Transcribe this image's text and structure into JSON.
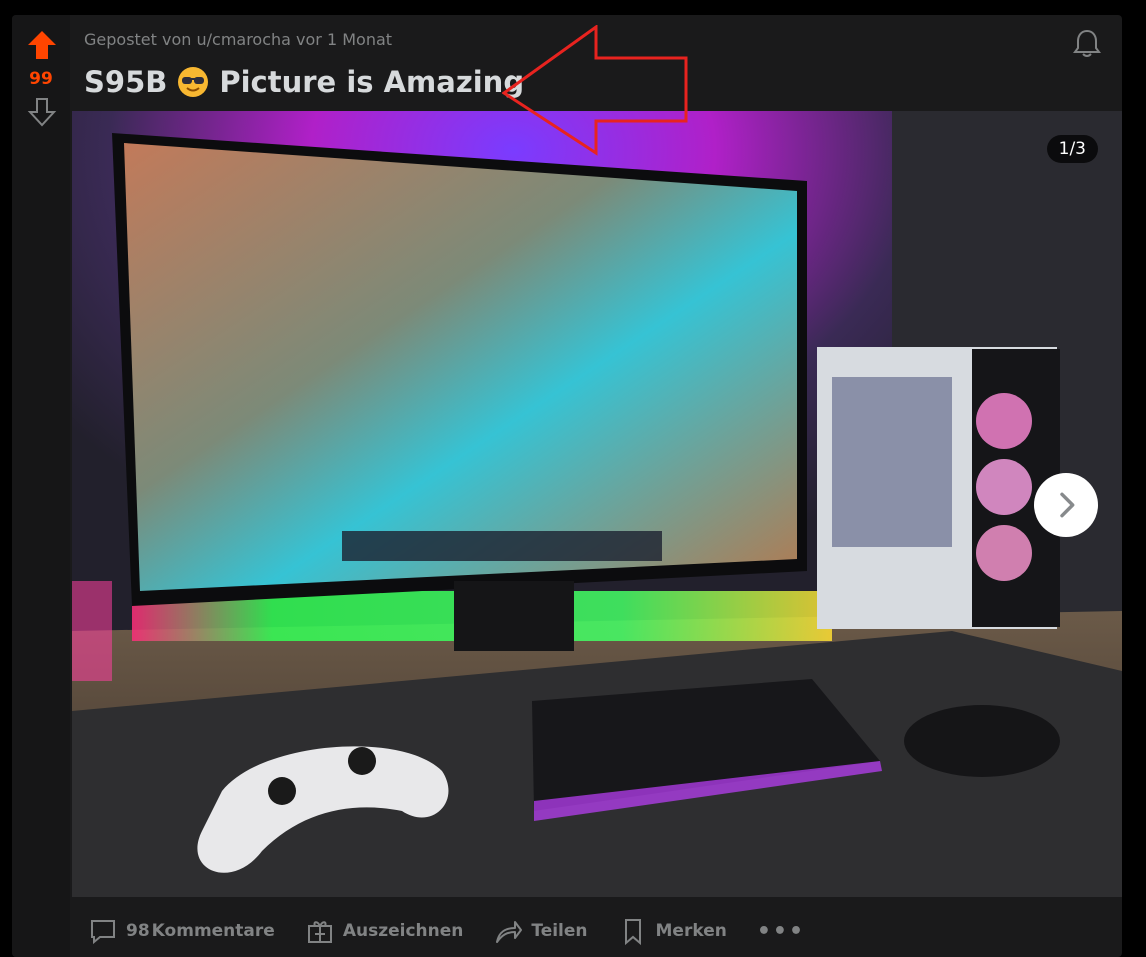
{
  "post": {
    "meta": "Gepostet von u/cmarocha vor 1 Monat",
    "title_text": "S95B",
    "title_rest": "Picture is Amazing",
    "score": "99",
    "media_counter": "1/3",
    "image_desc_icons": [
      "upvote-arrow-icon",
      "downvote-arrow-icon",
      "bell-icon",
      "sunglasses-emoji-icon",
      "chevron-right-icon"
    ]
  },
  "actions": {
    "comments_count": "98",
    "comments_label": "Kommentare",
    "award_label": "Auszeichnen",
    "share_label": "Teilen",
    "save_label": "Merken",
    "more_label": "•••"
  },
  "colors": {
    "accent_orange": "#ff4500",
    "muted": "#818384",
    "text": "#d7dadc",
    "annotation": "#e8231f"
  }
}
